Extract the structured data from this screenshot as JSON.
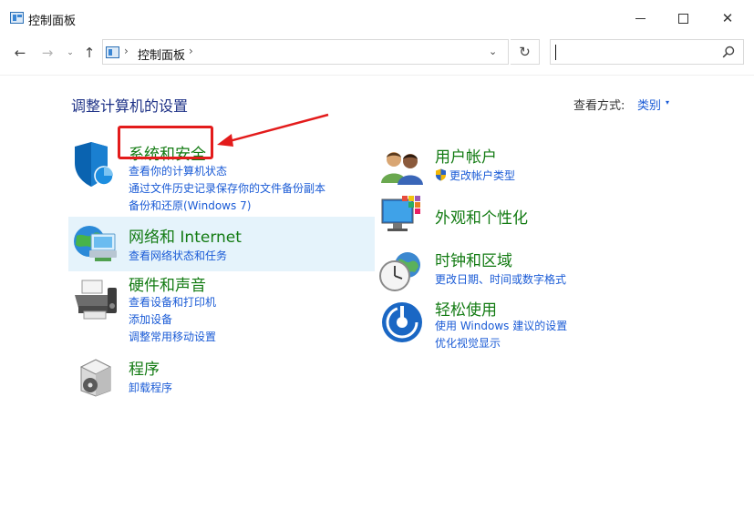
{
  "window": {
    "title": "控制面板",
    "minimize_glyph": "—",
    "close_glyph": "✕"
  },
  "nav": {
    "back_glyph": "←",
    "forward_glyph": "→",
    "recent_glyph": "⌄",
    "up_glyph": "↑",
    "separator_glyph": "›",
    "breadcrumb": "控制面板",
    "dropdown_glyph": "⌄",
    "refresh_glyph": "↻",
    "search_value": "",
    "search_placeholder": ""
  },
  "page": {
    "title": "调整计算机的设置",
    "view_by_label": "查看方式:",
    "view_by_value": "类别",
    "view_by_caret": "▾"
  },
  "categories": [
    {
      "id": "system-security",
      "title": "系统和安全",
      "links": [
        "查看你的计算机状态",
        "通过文件历史记录保存你的文件备份副本",
        "备份和还原(Windows 7)"
      ]
    },
    {
      "id": "network-internet",
      "title": "网络和 Internet",
      "links": [
        "查看网络状态和任务"
      ]
    },
    {
      "id": "hardware-sound",
      "title": "硬件和声音",
      "links": [
        "查看设备和打印机",
        "添加设备",
        "调整常用移动设置"
      ]
    },
    {
      "id": "programs",
      "title": "程序",
      "links": [
        "卸载程序"
      ]
    },
    {
      "id": "user-accounts",
      "title": "用户帐户",
      "links": [
        "更改帐户类型"
      ]
    },
    {
      "id": "appearance",
      "title": "外观和个性化",
      "links": []
    },
    {
      "id": "clock-region",
      "title": "时钟和区域",
      "links": [
        "更改日期、时间或数字格式"
      ]
    },
    {
      "id": "ease-of-access",
      "title": "轻松使用",
      "links": [
        "使用 Windows 建议的设置",
        "优化视觉显示"
      ]
    }
  ],
  "colors": {
    "category_title": "#137b13",
    "link": "#1a5bd6",
    "page_title": "#1e3287",
    "annotation": "#e31b1b",
    "hover": "#e5f3fb"
  }
}
